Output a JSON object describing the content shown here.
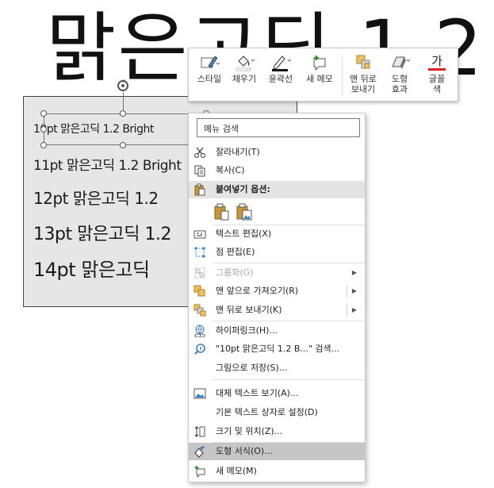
{
  "slide": {
    "title": "맑은고딕 1.2"
  },
  "textbox": {
    "lines": [
      "10pt 맑은고딕 1.2 Bright",
      "11pt 맑은고딕 1.2 Bright",
      "12pt 맑은고딕 1.2",
      "13pt 맑은고딕 1.2",
      "14pt 맑은고딕"
    ]
  },
  "mini_toolbar": {
    "style": "스타일",
    "fill": "채우기",
    "outline": "윤곽선",
    "new_comment": "새 메모",
    "send_back_1": "맨 뒤로",
    "send_back_2": "보내기",
    "effects_1": "도형",
    "effects_2": "효과",
    "font_color_glyph": "가",
    "font_color_1": "글꼴",
    "font_color_2": "색",
    "accent_red": "#e02020"
  },
  "context_menu": {
    "search_placeholder": "메뉴 검색",
    "cut": "잘라내기(T)",
    "copy": "복사(C)",
    "paste_options": "붙여넣기 옵션:",
    "edit_text": "텍스트 편집(X)",
    "edit_points": "점 편집(E)",
    "group": "그룹화(G)",
    "bring_front": "맨 앞으로 가져오기(R)",
    "send_back": "맨 뒤로 보내기(K)",
    "hyperlink": "하이퍼링크(H)...",
    "search_item": "\"10pt 맑은고딕 1.2 B...\" 검색...",
    "save_as_picture": "그림으로 저장(S)...",
    "alt_text": "대체 텍스트 보기(A)...",
    "default_textbox": "기본 텍스트 상자로 설정(D)",
    "size_position": "크기 및 위치(Z)...",
    "format_shape": "도형 서식(O)...",
    "new_comment": "새 메모(M)"
  }
}
